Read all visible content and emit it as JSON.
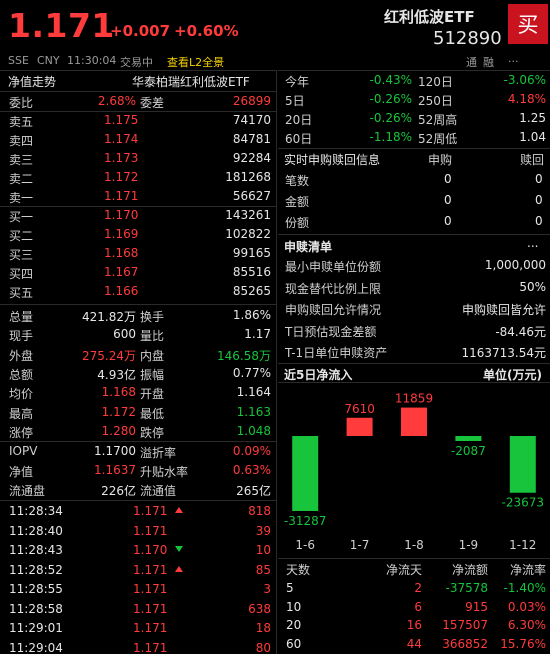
{
  "header": {
    "price": "1.171",
    "change": "+0.007",
    "change_pct": "+0.60%",
    "name": "红利低波ETF",
    "code": "512890",
    "buy_label": "买",
    "market": "SSE",
    "currency": "CNY",
    "time": "11:30:04",
    "status": "交易中",
    "l2_link": "查看L2全景",
    "tag_tong": "通",
    "tag_rong": "融",
    "tag_more": "..."
  },
  "left_top": {
    "title": "净值走势",
    "fund_name": "华泰柏瑞红利低波ETF"
  },
  "wei": {
    "weibi_label": "委比",
    "weibi": "2.68%",
    "weicha_label": "委差",
    "weicha": "26899"
  },
  "sells": [
    {
      "label": "卖五",
      "price": "1.175",
      "vol": "74170"
    },
    {
      "label": "卖四",
      "price": "1.174",
      "vol": "84781"
    },
    {
      "label": "卖三",
      "price": "1.173",
      "vol": "92284"
    },
    {
      "label": "卖二",
      "price": "1.172",
      "vol": "181268"
    },
    {
      "label": "卖一",
      "price": "1.171",
      "vol": "56627"
    }
  ],
  "buys": [
    {
      "label": "买一",
      "price": "1.170",
      "vol": "143261"
    },
    {
      "label": "买二",
      "price": "1.169",
      "vol": "102822"
    },
    {
      "label": "买三",
      "price": "1.168",
      "vol": "99165"
    },
    {
      "label": "买四",
      "price": "1.167",
      "vol": "85516"
    },
    {
      "label": "买五",
      "price": "1.166",
      "vol": "85265"
    }
  ],
  "stats": [
    {
      "l1": "总量",
      "v1": "421.82万",
      "c1": "white",
      "l2": "换手",
      "v2": "1.86%",
      "c2": "white"
    },
    {
      "l1": "现手",
      "v1": "600",
      "c1": "white",
      "l2": "量比",
      "v2": "1.17",
      "c2": "white"
    },
    {
      "l1": "外盘",
      "v1": "275.24万",
      "c1": "red",
      "l2": "内盘",
      "v2": "146.58万",
      "c2": "green"
    },
    {
      "l1": "总额",
      "v1": "4.93亿",
      "c1": "white",
      "l2": "振幅",
      "v2": "0.77%",
      "c2": "white"
    },
    {
      "l1": "均价",
      "v1": "1.168",
      "c1": "red",
      "l2": "开盘",
      "v2": "1.164",
      "c2": "white"
    },
    {
      "l1": "最高",
      "v1": "1.172",
      "c1": "red",
      "l2": "最低",
      "v2": "1.163",
      "c2": "green"
    },
    {
      "l1": "涨停",
      "v1": "1.280",
      "c1": "red",
      "l2": "跌停",
      "v2": "1.048",
      "c2": "green"
    }
  ],
  "iopv": [
    {
      "l1": "IOPV",
      "v1": "1.1700",
      "c1": "white",
      "l2": "溢折率",
      "v2": "0.09%",
      "c2": "red"
    },
    {
      "l1": "净值",
      "v1": "1.1637",
      "c1": "red",
      "l2": "升贴水率",
      "v2": "0.63%",
      "c2": "red"
    },
    {
      "l1": "流通盘",
      "v1": "226亿",
      "c1": "white",
      "l2": "流通值",
      "v2": "265亿",
      "c2": "white"
    }
  ],
  "ticks": [
    {
      "time": "11:28:34",
      "price": "1.171",
      "dir": "up",
      "vol": "818"
    },
    {
      "time": "11:28:40",
      "price": "1.171",
      "dir": "",
      "vol": "39"
    },
    {
      "time": "11:28:43",
      "price": "1.170",
      "dir": "down",
      "vol": "10"
    },
    {
      "time": "11:28:52",
      "price": "1.171",
      "dir": "up",
      "vol": "85"
    },
    {
      "time": "11:28:55",
      "price": "1.171",
      "dir": "",
      "vol": "3"
    },
    {
      "time": "11:28:58",
      "price": "1.171",
      "dir": "",
      "vol": "638"
    },
    {
      "time": "11:29:01",
      "price": "1.171",
      "dir": "",
      "vol": "18"
    },
    {
      "time": "11:29:04",
      "price": "1.171",
      "dir": "",
      "vol": "80"
    }
  ],
  "perf": [
    {
      "l1": "今年",
      "v1": "-0.43%",
      "c1": "green",
      "l2": "120日",
      "v2": "-3.06%",
      "c2": "green"
    },
    {
      "l1": "5日",
      "v1": "-0.26%",
      "c1": "green",
      "l2": "250日",
      "v2": "4.18%",
      "c2": "red"
    },
    {
      "l1": "20日",
      "v1": "-0.26%",
      "c1": "green",
      "l2": "52周高",
      "v2": "1.25",
      "c2": "white"
    },
    {
      "l1": "60日",
      "v1": "-1.18%",
      "c1": "green",
      "l2": "52周低",
      "v2": "1.04",
      "c2": "white"
    }
  ],
  "subscribe": {
    "title": "实时申购赎回信息",
    "col1": "申购",
    "col2": "赎回",
    "rows": [
      {
        "label": "笔数",
        "v1": "0",
        "v2": "0"
      },
      {
        "label": "金额",
        "v1": "0",
        "v2": "0"
      },
      {
        "label": "份额",
        "v1": "0",
        "v2": "0"
      }
    ]
  },
  "shushu": {
    "title": "申赎清单",
    "more": "...",
    "rows": [
      {
        "label": "最小申赎单位份额",
        "value": "1,000,000"
      },
      {
        "label": "现金替代比例上限",
        "value": "50%"
      },
      {
        "label": "申购赎回允许情况",
        "value": "申购赎回皆允许"
      },
      {
        "label": "T日预估现金差额",
        "value": "-84.46元"
      },
      {
        "label": "T-1日单位申赎资产",
        "value": "1163713.54元"
      }
    ]
  },
  "flow_chart": {
    "title": "近5日净流入",
    "unit": "单位(万元)"
  },
  "chart_data": {
    "type": "bar",
    "title": "近5日净流入",
    "ylabel": "单位(万元)",
    "categories": [
      "1-6",
      "1-7",
      "1-8",
      "1-9",
      "1-12"
    ],
    "values": [
      -31287,
      7610,
      11859,
      -2087,
      -23673
    ]
  },
  "flow_table": {
    "headers": [
      "天数",
      "净流天",
      "净流额",
      "净流率"
    ],
    "rows": [
      {
        "days": "5",
        "net_days": "2",
        "amount": "-37578",
        "rate": "-1.40%",
        "c": "green"
      },
      {
        "days": "10",
        "net_days": "6",
        "amount": "915",
        "rate": "0.03%",
        "c": "red"
      },
      {
        "days": "20",
        "net_days": "16",
        "amount": "157507",
        "rate": "6.30%",
        "c": "red"
      },
      {
        "days": "60",
        "net_days": "44",
        "amount": "366852",
        "rate": "15.76%",
        "c": "red"
      }
    ]
  },
  "colors": {
    "up": "#ff3b3b",
    "down": "#17c43c",
    "accent": "#f2d000",
    "buy_button": "#c9131e"
  }
}
